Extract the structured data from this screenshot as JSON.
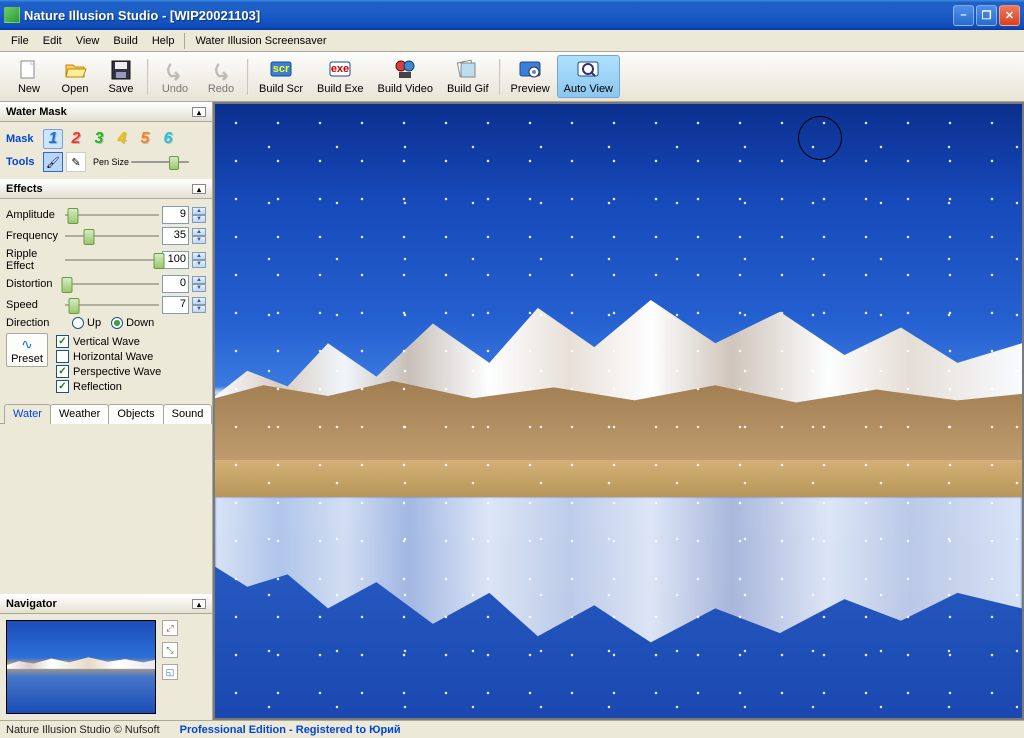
{
  "title": "Nature Illusion Studio - [WIP20021103]",
  "menu": {
    "file": "File",
    "edit": "Edit",
    "view": "View",
    "build": "Build",
    "help": "Help",
    "wis": "Water Illusion Screensaver"
  },
  "toolbar": {
    "new": "New",
    "open": "Open",
    "save": "Save",
    "undo": "Undo",
    "redo": "Redo",
    "buildscr": "Build Scr",
    "buildexe": "Build Exe",
    "buildvideo": "Build Video",
    "buildgif": "Build Gif",
    "preview": "Preview",
    "autoview": "Auto View"
  },
  "panels": {
    "watermask": "Water Mask",
    "effects": "Effects",
    "navigator": "Navigator"
  },
  "mask": {
    "label": "Mask",
    "tools": "Tools",
    "pensize": "Pen\nSize"
  },
  "effects": {
    "amplitude": {
      "label": "Amplitude",
      "value": "9",
      "pct": 9
    },
    "frequency": {
      "label": "Frequency",
      "value": "35",
      "pct": 25
    },
    "ripple": {
      "label": "Ripple Effect",
      "value": "100",
      "pct": 100
    },
    "distortion": {
      "label": "Distortion",
      "value": "0",
      "pct": 2
    },
    "speed": {
      "label": "Speed",
      "value": "7",
      "pct": 10
    },
    "direction": {
      "label": "Direction",
      "up": "Up",
      "down": "Down"
    },
    "vertical": "Vertical Wave",
    "horizontal": "Horizontal Wave",
    "perspective": "Perspective Wave",
    "reflection": "Reflection",
    "preset": "Preset"
  },
  "tabs": {
    "water": "Water",
    "weather": "Weather",
    "objects": "Objects",
    "sound": "Sound"
  },
  "status": {
    "left": "Nature Illusion Studio © Nufsoft",
    "right": "Professional Edition - Registered to Юрий"
  }
}
